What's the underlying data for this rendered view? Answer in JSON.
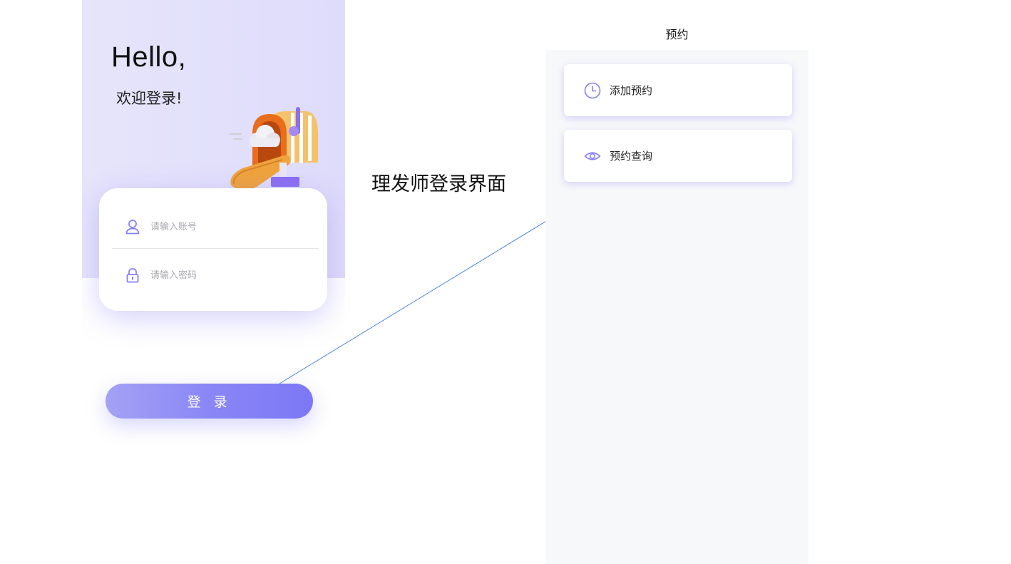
{
  "login": {
    "greeting": "Hello,",
    "welcome": "欢迎登录!",
    "account_placeholder": "请输入账号",
    "password_placeholder": "请输入密码",
    "login_button": "登 录",
    "icons": {
      "account": "user-icon",
      "password": "lock-icon",
      "illustration": "mailbox-illustration"
    }
  },
  "caption": "理发师登录界面",
  "appointment": {
    "title": "预约",
    "menu": [
      {
        "label": "添加预约",
        "icon": "clock-icon"
      },
      {
        "label": "预约查询",
        "icon": "eye-icon"
      }
    ]
  },
  "colors": {
    "accent": "#8480f6",
    "header_gradient": [
      "#e6e5fb",
      "#dedcfb"
    ],
    "button_gradient": [
      "#a4a2f4",
      "#7c78f6"
    ],
    "page_background": "#f7f8fa"
  }
}
